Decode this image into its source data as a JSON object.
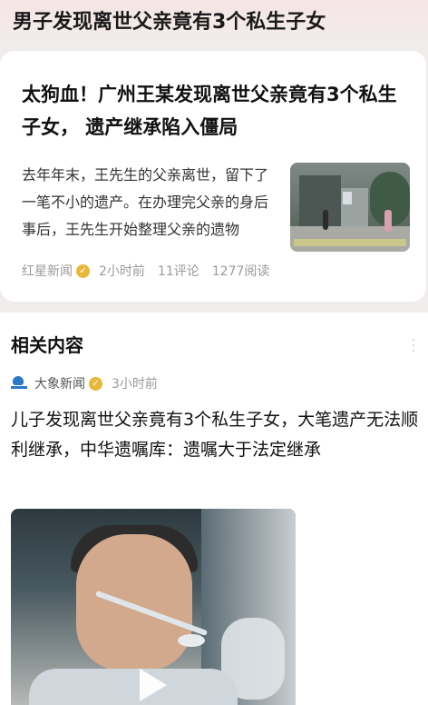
{
  "banner": {
    "title": "男子发现离世父亲竟有3个私生子女"
  },
  "article": {
    "title": "太狗血！广州王某发现离世父亲竟有3个私生子女， 遗产继承陷入僵局",
    "summary": "去年年末，王先生的父亲离世，留下了一笔不小的遗产。在办理完父亲的身后事后，王先生开始整理父亲的遗物",
    "thumbnail_icon": "news-photo",
    "source": "红星新闻",
    "verified_icon": "verified-badge-icon",
    "time": "2小时前",
    "comments": "11评论",
    "reads": "1277阅读"
  },
  "related": {
    "heading": "相关内容",
    "source": "大象新闻",
    "time": "3小时前",
    "headline": "儿子发现离世父亲竟有3个私生子女，大笔遗产无法顺利继承，中华遗嘱库：遗嘱大于法定继承",
    "video_icon": "play-icon"
  },
  "colors": {
    "banner_bg": "#f6e5e5",
    "verified": "#e7b93b",
    "source_logo": "#2a78c8"
  }
}
